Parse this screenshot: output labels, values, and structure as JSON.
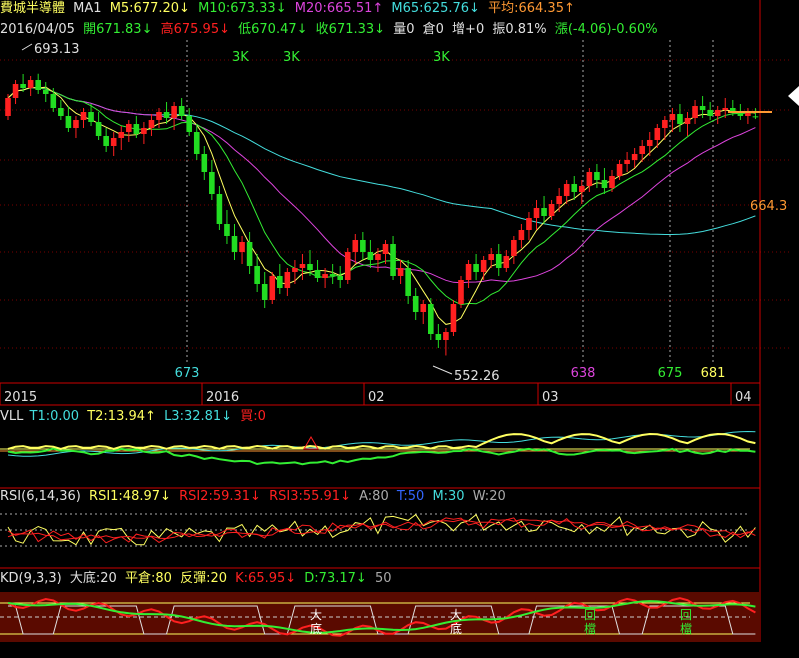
{
  "header": {
    "name": "費城半導體",
    "ma_label": "MA1",
    "m5": "M5:677.20↓",
    "m10": "M10:673.33↓",
    "m20": "M20:665.51↑",
    "m65": "M65:625.76↓",
    "avg": "平均:664.35↑",
    "date": "2016/04/05",
    "open": "開671.83↓",
    "high": "高675.95↓",
    "low": "低670.47↓",
    "close": "收671.33↓",
    "vol": "量0",
    "oi": "倉0",
    "inc": "增+0",
    "amp": "振0.81%",
    "chg": "漲(-4.06)-0.60%"
  },
  "colors": {
    "up": "#ff2020",
    "down": "#22dd22",
    "m5": "#ffff60",
    "m10": "#33ee33",
    "m20": "#dd44dd",
    "m65": "#44dddd",
    "grid": "#7a0000",
    "axis": "#cc0000",
    "cyan_text": "#44dddd",
    "orange": "#ff9933",
    "white": "#e0e0e0"
  },
  "chart_data": {
    "type": "candlestick",
    "title": "費城半導體",
    "ylim": [
      540,
      710
    ],
    "annotations": {
      "max_label": "693.13",
      "min_label": "552.26",
      "right_label": "664.3",
      "k3_labels": [
        "3K",
        "3K",
        "3K"
      ],
      "vline_labels": [
        {
          "text": "673",
          "color": "#44dddd"
        },
        {
          "text": "638",
          "color": "#dd44dd"
        },
        {
          "text": "675",
          "color": "#33ee33"
        },
        {
          "text": "681",
          "color": "#ffff60"
        }
      ]
    },
    "x_ticks": [
      "2015",
      "2016",
      "02",
      "03",
      "04"
    ],
    "candles": [
      [
        672,
        683,
        670,
        681
      ],
      [
        681,
        690,
        678,
        688
      ],
      [
        688,
        693,
        684,
        686
      ],
      [
        686,
        692,
        682,
        690
      ],
      [
        690,
        693.13,
        683,
        685
      ],
      [
        685,
        689,
        679,
        683
      ],
      [
        683,
        686,
        674,
        676
      ],
      [
        676,
        680,
        670,
        672
      ],
      [
        672,
        677,
        664,
        666
      ],
      [
        666,
        672,
        661,
        670
      ],
      [
        670,
        676,
        666,
        674
      ],
      [
        674,
        678,
        667,
        669
      ],
      [
        669,
        674,
        660,
        662
      ],
      [
        662,
        666,
        654,
        657
      ],
      [
        657,
        664,
        652,
        661
      ],
      [
        661,
        667,
        655,
        664
      ],
      [
        664,
        670,
        659,
        668
      ],
      [
        668,
        672,
        661,
        663
      ],
      [
        663,
        669,
        658,
        666
      ],
      [
        666,
        673,
        662,
        670
      ],
      [
        670,
        676,
        666,
        674
      ],
      [
        674,
        679,
        668,
        671
      ],
      [
        671,
        679,
        665,
        677
      ],
      [
        677,
        681,
        670,
        672
      ],
      [
        672,
        676,
        662,
        664
      ],
      [
        664,
        668,
        650,
        653
      ],
      [
        653,
        657,
        640,
        644
      ],
      [
        644,
        650,
        630,
        633
      ],
      [
        633,
        637,
        615,
        618
      ],
      [
        618,
        625,
        608,
        612
      ],
      [
        612,
        618,
        600,
        604
      ],
      [
        604,
        612,
        598,
        609
      ],
      [
        609,
        614,
        593,
        597
      ],
      [
        597,
        603,
        584,
        588
      ],
      [
        588,
        594,
        576,
        580
      ],
      [
        580,
        594,
        578,
        592
      ],
      [
        592,
        598,
        583,
        586
      ],
      [
        586,
        596,
        582,
        594
      ],
      [
        594,
        600,
        588,
        596
      ],
      [
        596,
        603,
        590,
        598
      ],
      [
        598,
        605,
        592,
        595
      ],
      [
        595,
        600,
        589,
        591
      ],
      [
        591,
        596,
        586,
        593
      ],
      [
        593,
        598,
        588,
        592
      ],
      [
        592,
        597,
        586,
        590
      ],
      [
        590,
        606,
        588,
        604
      ],
      [
        604,
        613,
        598,
        610
      ],
      [
        610,
        614,
        600,
        604
      ],
      [
        604,
        610,
        596,
        600
      ],
      [
        600,
        606,
        594,
        603
      ],
      [
        603,
        610,
        598,
        608
      ],
      [
        608,
        612,
        590,
        592
      ],
      [
        592,
        600,
        588,
        596
      ],
      [
        596,
        600,
        578,
        582
      ],
      [
        582,
        586,
        570,
        574
      ],
      [
        574,
        580,
        568,
        578
      ],
      [
        578,
        581,
        560,
        563
      ],
      [
        563,
        568,
        556,
        560
      ],
      [
        560,
        566,
        552.26,
        564
      ],
      [
        564,
        580,
        562,
        578
      ],
      [
        578,
        592,
        576,
        590
      ],
      [
        590,
        600,
        586,
        598
      ],
      [
        598,
        603,
        590,
        594
      ],
      [
        594,
        602,
        590,
        600
      ],
      [
        600,
        606,
        596,
        603
      ],
      [
        603,
        608,
        592,
        596
      ],
      [
        596,
        605,
        594,
        602
      ],
      [
        602,
        612,
        598,
        610
      ],
      [
        610,
        618,
        606,
        615
      ],
      [
        615,
        624,
        610,
        621
      ],
      [
        621,
        630,
        615,
        626
      ],
      [
        626,
        632,
        618,
        622
      ],
      [
        622,
        630,
        620,
        628
      ],
      [
        628,
        636,
        624,
        632
      ],
      [
        632,
        640,
        628,
        638
      ],
      [
        638,
        642,
        630,
        634
      ],
      [
        634,
        640,
        628,
        637
      ],
      [
        637,
        646,
        634,
        644
      ],
      [
        644,
        648,
        636,
        640
      ],
      [
        640,
        646,
        633,
        636
      ],
      [
        636,
        645,
        634,
        642
      ],
      [
        642,
        650,
        640,
        648
      ],
      [
        648,
        654,
        644,
        650
      ],
      [
        650,
        656,
        646,
        653
      ],
      [
        653,
        660,
        649,
        657
      ],
      [
        657,
        664,
        652,
        660
      ],
      [
        660,
        668,
        656,
        666
      ],
      [
        666,
        672,
        660,
        670
      ],
      [
        670,
        676,
        664,
        673
      ],
      [
        673,
        678,
        664,
        668
      ],
      [
        668,
        674,
        662,
        671
      ],
      [
        671,
        680,
        668,
        677
      ],
      [
        677,
        682,
        671,
        675
      ],
      [
        675,
        679,
        670,
        672
      ],
      [
        672,
        677,
        668,
        675
      ],
      [
        675,
        681,
        671,
        676
      ],
      [
        676,
        680,
        672,
        674
      ],
      [
        674,
        678,
        670,
        672
      ],
      [
        672,
        676,
        668,
        674
      ],
      [
        671.83,
        675.95,
        670.47,
        671.33
      ]
    ]
  },
  "time_axis": [
    "2015",
    "2016",
    "02",
    "03",
    "04"
  ],
  "indicators": {
    "vll": {
      "label": "VLL",
      "t1": "T1:0.00",
      "t2": "T2:13.94↑",
      "l3": "L3:32.81↓",
      "buy": "買:0"
    },
    "rsi": {
      "label": "RSI(6,14,36)",
      "rsi1": "RSI1:48.97↓",
      "rsi2": "RSI2:59.31↓",
      "rsi3": "RSI3:55.91↓",
      "a": "A:80",
      "t": "T:50",
      "m": "M:30",
      "w": "W:20"
    },
    "kd": {
      "label": "KD(9,3,3)",
      "big_bottom": "大底:20",
      "neutral": "平倉:80",
      "rebound": "反彈:20",
      "k": "K:65.95↓",
      "d": "D:73.17↓",
      "level": "50",
      "marks": [
        "大底",
        "大底",
        "回檔",
        "回檔"
      ]
    }
  }
}
